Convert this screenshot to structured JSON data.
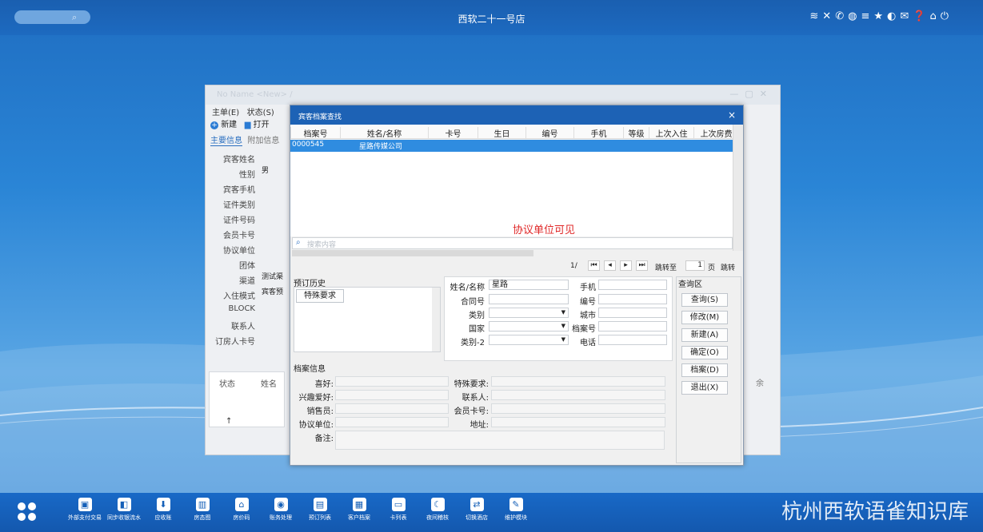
{
  "topbar": {
    "title": "西软二十一号店",
    "icons": [
      "wifi-icon",
      "tools-icon",
      "phone-icon",
      "palette-icon",
      "menu-icon",
      "star-icon",
      "moon-icon",
      "mail-icon",
      "help-icon",
      "home-icon",
      "power-icon"
    ]
  },
  "backwin": {
    "title": "No Name <New> /",
    "menu": [
      "主单(E)",
      "状态(S)"
    ],
    "toolbar": {
      "new": "新建",
      "open": "打开"
    },
    "tabs": [
      "主要信息",
      "附加信息"
    ],
    "fields": [
      {
        "label": "宾客姓名",
        "value": ""
      },
      {
        "label": "性别",
        "value": "男"
      },
      {
        "label": "宾客手机",
        "value": ""
      },
      {
        "label": "证件类别",
        "value": ""
      },
      {
        "label": "证件号码",
        "value": ""
      },
      {
        "label": "会员卡号",
        "value": ""
      },
      {
        "label": "协议单位",
        "value": ""
      },
      {
        "label": "团体",
        "value": ""
      },
      {
        "label": "渠道",
        "value": "测试渠"
      },
      {
        "label": "入住模式",
        "value": "宾客预"
      },
      {
        "label": "BLOCK",
        "value": ""
      },
      {
        "label": "联系人",
        "value": ""
      },
      {
        "label": "订房人卡号",
        "value": ""
      }
    ],
    "table_headers": [
      "状态",
      "姓名"
    ],
    "right_col": "余"
  },
  "dialog": {
    "title": "宾客档案查找",
    "close": "×",
    "columns": [
      "档案号",
      "姓名/名称",
      "卡号",
      "生日",
      "编号",
      "手机",
      "等级",
      "上次入住",
      "上次房费"
    ],
    "rows": [
      {
        "id": "0000545",
        "name": "星路传媒公司"
      }
    ],
    "notice": "协议单位可见",
    "search_placeholder": "搜索内容",
    "pager": {
      "page": "1/",
      "jump_label": "跳转至",
      "page_no": "1",
      "page_unit": "页",
      "jump_btn": "跳转"
    },
    "history": {
      "title": "预订历史",
      "special_btn": "特殊要求"
    },
    "query": {
      "name_label": "姓名/名称",
      "name_value": "星路",
      "contract_label": "合同号",
      "category_label": "类别",
      "country_label": "国家",
      "category2_label": "类别-2",
      "phone_label": "手机",
      "code_label": "编号",
      "city_label": "城市",
      "archive_no_label": "档案号",
      "tel_label": "电话"
    },
    "query_area": {
      "title": "查询区",
      "buttons": [
        "查询(S)",
        "修改(M)",
        "新建(A)",
        "确定(O)",
        "档案(D)",
        "退出(X)"
      ]
    },
    "profile": {
      "title": "档案信息",
      "left": [
        "喜好:",
        "兴趣爱好:",
        "销售员:",
        "协议单位:",
        "备注:"
      ],
      "right": [
        "特殊要求:",
        "联系人:",
        "会员卡号:",
        "地址:"
      ]
    }
  },
  "taskbar": {
    "items": [
      "外部支付交易",
      "同步收银流水",
      "应收账",
      "房态图",
      "房价码",
      "账务处理",
      "预订列表",
      "客户档案",
      "卡列表",
      "夜间稽核",
      "切换酒店",
      "维护模块"
    ],
    "watermark": "杭州西软语雀知识库"
  }
}
